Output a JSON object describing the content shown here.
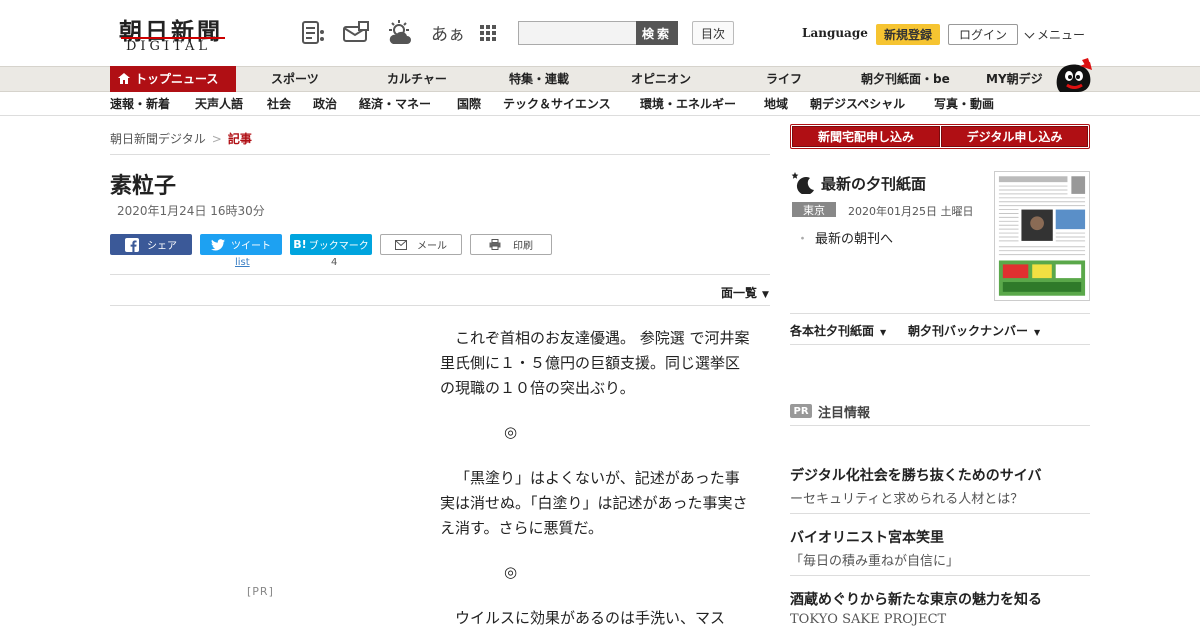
{
  "header": {
    "logo_kanji": "朝日新聞",
    "logo_en": "DIGITAL",
    "icons": [
      "news-list-icon",
      "mail-newspaper-icon",
      "weather-icon",
      "font-size-icon",
      "apps-grid-icon"
    ],
    "font_size_label": "あぁ",
    "search": {
      "placeholder": "",
      "button": "検索"
    },
    "toc": "目次",
    "language": "Language",
    "register": "新規登録",
    "login": "ログイン",
    "menu": "メニュー"
  },
  "nav_main": [
    "トップニュース",
    "スポーツ",
    "カルチャー",
    "特集・連載",
    "オピニオン",
    "ライフ",
    "朝夕刊紙面・be",
    "MY朝デジ"
  ],
  "nav_sub": [
    "速報・新着",
    "天声人語",
    "社会",
    "政治",
    "経済・マネー",
    "国際",
    "テック＆サイエンス",
    "環境・エネルギー",
    "地域",
    "朝デジスペシャル",
    "写真・動画"
  ],
  "breadcrumb": {
    "home": "朝日新聞デジタル",
    "sep": ">",
    "current": "記事"
  },
  "article": {
    "title": "素粒子",
    "date": "2020年1月24日 16時30分",
    "share": {
      "facebook": "シェア",
      "twitter": "ツイート",
      "twitter_count": "list",
      "hatena": "ブックマーク",
      "hatena_count": "4",
      "mail": "メール",
      "print": "印刷"
    },
    "page_list": "面一覧",
    "paragraphs": [
      "これぞ首相のお友達優遇。 参院選 で河井案里氏側に１・５億円の巨額支援。同じ選挙区の現職の１０倍の突出ぶり。",
      "「黒塗り」はよくないが、記述があった事実は消せぬ。「白塗り」は記述があった事実さえ消す。さらに悪質だ。",
      "ウイルスに効果があるのは手洗い、マス"
    ],
    "separator": "◎",
    "pr_label": "[PR]"
  },
  "sidebar": {
    "home_delivery": "新聞宅配申し込み",
    "digital_signup": "デジタル申し込み",
    "evening_title": "最新の夕刊紙面",
    "region": "東京",
    "edition_date": "2020年01月25日 土曜日",
    "morning_link": "最新の朝刊へ",
    "dropdown1": "各本社夕刊紙面",
    "dropdown2": "朝夕刊バックナンバー",
    "pr_badge": "PR",
    "featured": "注目情報",
    "ads": [
      {
        "headline": "デジタル化社会を勝ち抜くためのサイバ",
        "sub": "ーセキュリティと求められる人材とは？"
      },
      {
        "headline": "バイオリニスト宮本笑里",
        "sub": "「毎日の積み重ねが自信に」"
      },
      {
        "headline": "酒蔵めぐりから新たな東京の魅力を知る",
        "sub": "TOKYO SAKE PROJECT"
      }
    ]
  },
  "colors": {
    "brand_red": "#b00f14",
    "register_yellow": "#f6c431",
    "facebook": "#3b5998",
    "twitter": "#1da1f2",
    "hatena": "#00a4de"
  }
}
